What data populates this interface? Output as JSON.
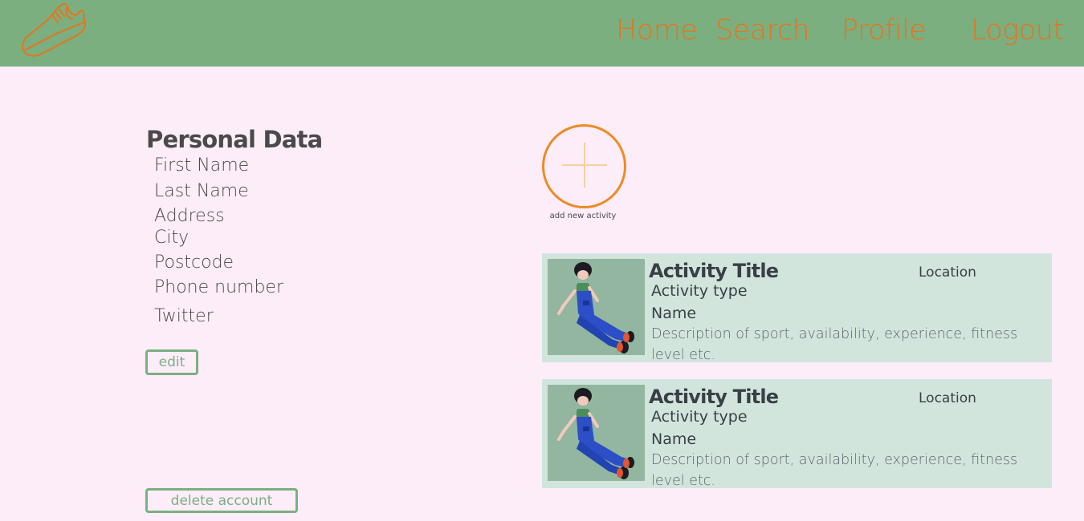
{
  "nav": {
    "logo_icon": "sneaker-icon",
    "links": [
      "Home",
      "Search",
      "Profile",
      "Logout"
    ]
  },
  "personal": {
    "title": "Personal Data",
    "fields": [
      "First Name",
      "Last Name",
      "Address",
      "City",
      "Postcode",
      "Phone number",
      "Twitter"
    ],
    "edit_label": "edit",
    "delete_label": "delete account"
  },
  "add_activity": {
    "icon": "plus-icon",
    "label": "add new activity"
  },
  "activities": [
    {
      "title": "Activity Title",
      "location": "Location",
      "type": "Activity type",
      "name": "Name",
      "description": "Description of sport, availability, experience, fitness level etc."
    },
    {
      "title": "Activity Title",
      "location": "Location",
      "type": "Activity type",
      "name": "Name",
      "description": "Description of sport, availability, experience, fitness level etc."
    }
  ],
  "colors": {
    "header_bg": "#7baf7f",
    "page_bg": "#fcedf9",
    "accent_orange": "#e8731c",
    "card_bg": "#d2e5dc",
    "card_image_bg": "#92b69f"
  }
}
